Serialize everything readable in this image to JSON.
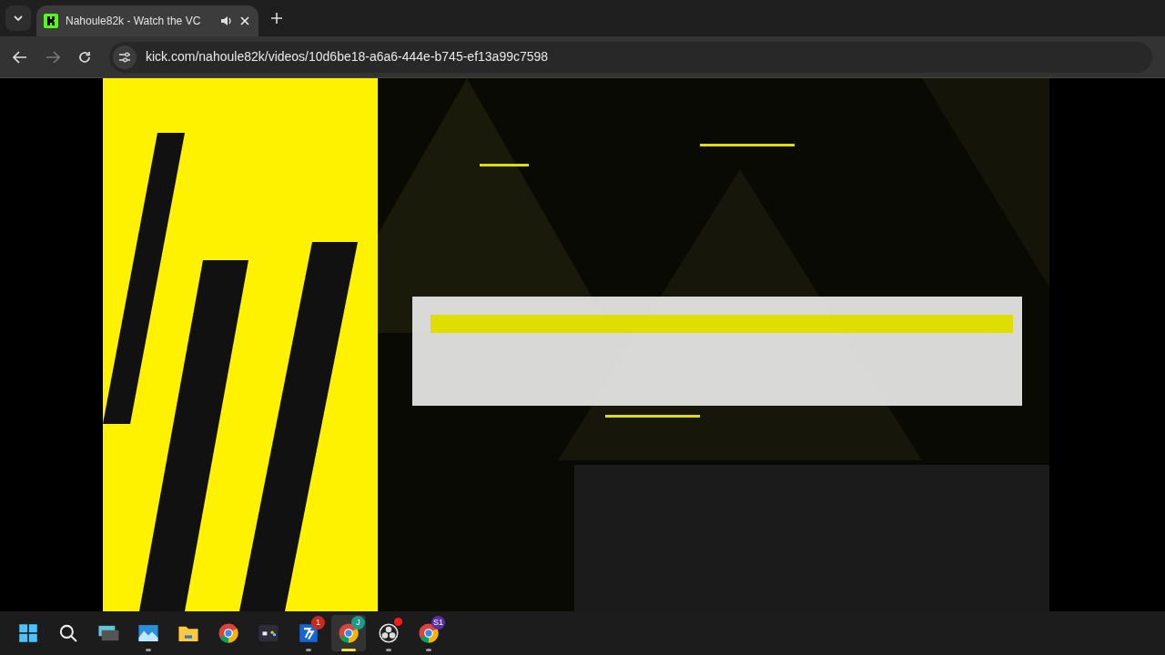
{
  "tab": {
    "title": "Nahoule82k - Watch the VC",
    "selected": true
  },
  "address_bar": {
    "url": "kick.com/nahoule82k/videos/10d6be18-a6a6-444e-b745-ef13a99c7598"
  },
  "taskbar": {
    "items": [
      {
        "kind": "start",
        "running": false,
        "selected": false
      },
      {
        "kind": "search",
        "running": false,
        "selected": false
      },
      {
        "kind": "keyboard",
        "running": false,
        "selected": false
      },
      {
        "kind": "photos",
        "running": true,
        "selected": false
      },
      {
        "kind": "folder",
        "running": false,
        "selected": false
      },
      {
        "kind": "chrome",
        "running": false,
        "selected": false
      },
      {
        "kind": "gamepad",
        "running": false,
        "selected": false
      },
      {
        "kind": "blue-app",
        "running": true,
        "selected": false,
        "badge": "1"
      },
      {
        "kind": "chrome",
        "running": true,
        "selected": true,
        "badge": "J"
      },
      {
        "kind": "obs",
        "running": true,
        "selected": false,
        "alert": true
      },
      {
        "kind": "chrome",
        "running": true,
        "selected": false,
        "badge": "S1"
      }
    ]
  }
}
